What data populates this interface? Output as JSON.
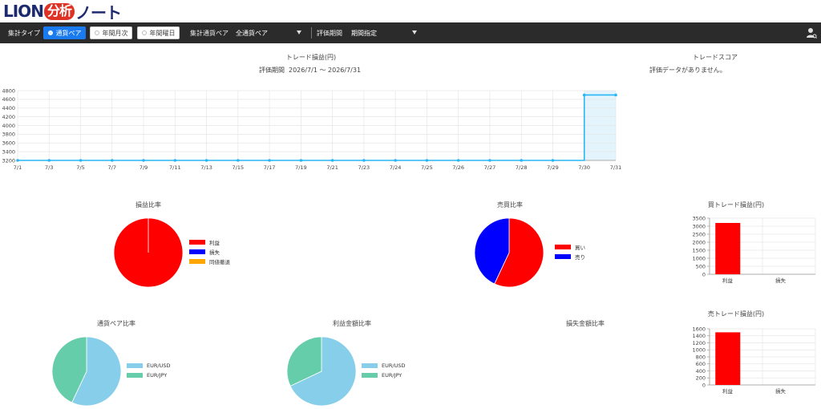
{
  "logo": {
    "part1": "LION",
    "part2": "分析",
    "part3": "ノート"
  },
  "toolbar": {
    "aggregate_type_label": "集計タイプ",
    "buttons": [
      {
        "label": "通貨ペア",
        "active": true
      },
      {
        "label": "年間月次",
        "active": false
      },
      {
        "label": "年間曜日",
        "active": false
      }
    ],
    "pair_label": "集計通貨ペア",
    "pair_value": "全通貨ペア",
    "period_label": "評価期間",
    "period_value": "期間指定"
  },
  "main_chart": {
    "title": "トレード損益(円)",
    "period_label": "評価期間",
    "period_value": "2026/7/1 〜 2026/7/31"
  },
  "trade_score": {
    "title": "トレードスコア",
    "message": "評価データがありません。"
  },
  "pie_titles": {
    "pl_ratio": "損益比率",
    "buysell_ratio": "売買比率",
    "pair_ratio": "通貨ペア比率",
    "profit_amount_ratio": "利益金額比率",
    "loss_amount_ratio": "損失金額比率"
  },
  "bar_titles": {
    "buy_trade": "買トレード損益(円)",
    "sell_trade": "売トレード損益(円)"
  },
  "chart_data": [
    {
      "type": "line",
      "title": "トレード損益(円)",
      "x": [
        "7/1",
        "7/3",
        "7/5",
        "7/7",
        "7/9",
        "7/11",
        "7/13",
        "7/15",
        "7/17",
        "7/19",
        "7/21",
        "7/23",
        "7/24",
        "7/25",
        "7/26",
        "7/27",
        "7/28",
        "7/29",
        "7/30",
        "7/31"
      ],
      "series": [
        {
          "values": [
            3200,
            3200,
            3200,
            3200,
            3200,
            3200,
            3200,
            3200,
            3200,
            3200,
            3200,
            3200,
            3200,
            3200,
            3200,
            3200,
            3200,
            3200,
            4700,
            4700
          ],
          "color": "#29b6f6"
        }
      ],
      "yticks": [
        3200,
        3400,
        3600,
        3800,
        4000,
        4200,
        4400,
        4600,
        4800
      ],
      "ylim": [
        3200,
        4800
      ],
      "shaded_range": [
        "7/30",
        "7/31"
      ],
      "grid": true
    },
    {
      "type": "pie",
      "title": "損益比率",
      "labels": [
        "利益",
        "損失",
        "同値撤退"
      ],
      "values": [
        100,
        0,
        0
      ],
      "colors": [
        "#ff0000",
        "#0000ff",
        "#ffa500"
      ]
    },
    {
      "type": "pie",
      "title": "売買比率",
      "labels": [
        "買い",
        "売り"
      ],
      "values": [
        57,
        43
      ],
      "colors": [
        "#ff0000",
        "#0000ff"
      ]
    },
    {
      "type": "pie",
      "title": "通貨ペア比率",
      "labels": [
        "EUR/USD",
        "EUR/JPY"
      ],
      "values": [
        57,
        43
      ],
      "colors": [
        "#87ceeb",
        "#66cdaa"
      ]
    },
    {
      "type": "pie",
      "title": "利益金額比率",
      "labels": [
        "EUR/USD",
        "EUR/JPY"
      ],
      "values": [
        68,
        32
      ],
      "colors": [
        "#87ceeb",
        "#66cdaa"
      ]
    },
    {
      "type": "bar",
      "title": "買トレード損益(円)",
      "categories": [
        "利益",
        "損失"
      ],
      "values": [
        3200,
        0
      ],
      "yticks": [
        0,
        500,
        1000,
        1500,
        2000,
        2500,
        3000,
        3500
      ],
      "ylim": [
        0,
        3500
      ],
      "color": "#ff0000"
    },
    {
      "type": "bar",
      "title": "売トレード損益(円)",
      "categories": [
        "利益",
        "損失"
      ],
      "values": [
        1500,
        0
      ],
      "yticks": [
        0,
        200,
        400,
        600,
        800,
        1000,
        1200,
        1400,
        1600
      ],
      "ylim": [
        0,
        1600
      ],
      "color": "#ff0000"
    }
  ]
}
